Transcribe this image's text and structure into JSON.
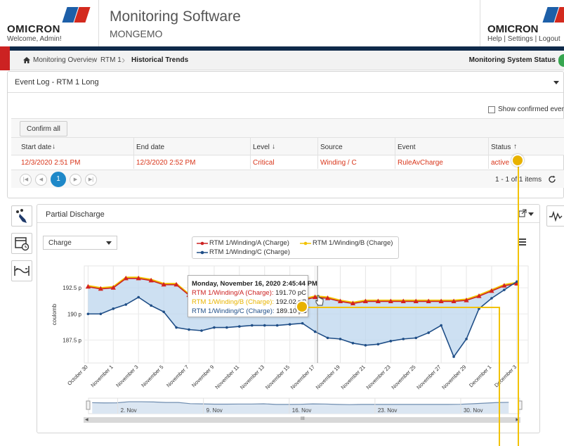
{
  "header": {
    "brand_left": "OMICRON",
    "welcome": "Welcome, Admin!",
    "title": "Monitoring Software",
    "subtitle": "MONGEMO",
    "brand_right": "OMICRON",
    "links": "Help | Settings | Logout"
  },
  "breadcrumb": {
    "items": [
      "Monitoring Overview",
      "RTM 1",
      "Historical Trends"
    ],
    "system_status": "Monitoring System Status"
  },
  "event_log": {
    "title": "Event Log - RTM 1 Long",
    "show_confirmed_label": "Show confirmed events",
    "confirm_all_label": "Confirm all",
    "columns": [
      "Start date",
      "End date",
      "Level",
      "Source",
      "Event",
      "Status"
    ],
    "rows": [
      [
        "12/3/2020 2:51 PM",
        "12/3/2020 2:52 PM",
        "Critical",
        "Winding / C",
        "RuleAvCharge",
        "active"
      ]
    ],
    "pager": {
      "current_page": "1",
      "summary": "1 - 1 of 1 items"
    },
    "colors": {
      "critical": "#d9361b",
      "pager_active": "#1e88c8"
    }
  },
  "chart_panel": {
    "title": "Partial Discharge",
    "select_value": "Charge",
    "tooltip": {
      "date": "Monday, November 16, 2020 2:45:44 PM",
      "a_label": "RTM 1/Winding/A (Charge):",
      "a_value": "191.70 pC",
      "b_label": "RTM 1/Winding/B (Charge):",
      "b_value": "192.02 pC",
      "c_label": "RTM 1/Winding/C (Charge):",
      "c_value": "189.10 pC"
    },
    "navigator_labels": [
      "2. Nov",
      "9. Nov",
      "16. Nov",
      "23. Nov",
      "30. Nov"
    ],
    "scrollbar_grip": "III"
  },
  "chart_data": {
    "type": "line",
    "title": "",
    "xlabel": "",
    "ylabel": "coulomb",
    "yticks": [
      "187.5 p",
      "190 p",
      "192.5 p"
    ],
    "ytick_values": [
      187.5,
      190,
      192.5
    ],
    "ylim": [
      185.3,
      194.6
    ],
    "xticks": [
      "October 30",
      "November 1",
      "November 3",
      "November 5",
      "November 7",
      "November 9",
      "November 11",
      "November 13",
      "November 15",
      "November 17",
      "November 19",
      "November 21",
      "November 23",
      "November 25",
      "November 27",
      "November 29",
      "December 1",
      "December 3"
    ],
    "xtick_days": [
      0,
      2,
      4,
      6,
      8,
      10,
      12,
      14,
      16,
      18,
      20,
      22,
      24,
      26,
      28,
      30,
      32,
      34
    ],
    "xlim": [
      -0.3,
      34.9
    ],
    "series": [
      {
        "name": "RTM 1/Winding/A (Charge)",
        "color": "#cc2222",
        "marker": "triangle",
        "days": [
          0,
          1,
          2,
          3,
          4,
          5,
          6,
          7,
          8,
          9,
          10,
          11,
          12,
          13,
          14,
          15,
          16,
          17,
          18,
          19,
          20,
          21,
          22,
          23,
          24,
          25,
          26,
          27,
          28,
          29,
          30,
          31,
          32,
          33,
          34
        ],
        "values": [
          192.6,
          192.4,
          192.5,
          193.4,
          193.4,
          193.2,
          192.8,
          192.8,
          191.8,
          191.6,
          191.4,
          191.4,
          191.5,
          191.5,
          191.7,
          191.2,
          191.2,
          191.3,
          191.6,
          191.5,
          191.2,
          191.0,
          191.2,
          191.2,
          191.2,
          191.2,
          191.2,
          191.2,
          191.2,
          191.2,
          191.3,
          191.7,
          192.2,
          192.7,
          192.9
        ]
      },
      {
        "name": "RTM 1/Winding/B (Charge)",
        "color": "#f2c200",
        "marker": "none",
        "days": [
          0,
          1,
          2,
          3,
          4,
          5,
          6,
          7,
          8,
          9,
          10,
          11,
          12,
          13,
          14,
          15,
          16,
          17,
          18,
          19,
          20,
          21,
          22,
          23,
          24,
          25,
          26,
          27,
          28,
          29,
          30,
          31,
          32,
          33,
          34
        ],
        "values": [
          192.7,
          192.5,
          192.6,
          193.5,
          193.5,
          193.3,
          192.9,
          192.9,
          191.9,
          191.7,
          191.5,
          191.5,
          191.6,
          191.6,
          191.8,
          191.3,
          191.3,
          191.4,
          191.7,
          191.6,
          191.3,
          191.1,
          191.3,
          191.3,
          191.3,
          191.3,
          191.3,
          191.3,
          191.3,
          191.3,
          191.4,
          191.8,
          192.3,
          192.8,
          193.0
        ]
      },
      {
        "name": "RTM 1/Winding/C (Charge)",
        "color": "#1f4e87",
        "marker": "none",
        "days": [
          0,
          1,
          2,
          3,
          4,
          5,
          6,
          7,
          8,
          9,
          10,
          11,
          12,
          13,
          14,
          15,
          16,
          17,
          18,
          19,
          20,
          21,
          22,
          23,
          24,
          25,
          26,
          27,
          28,
          29,
          30,
          31,
          32,
          33,
          34
        ],
        "values": [
          190.0,
          190.0,
          190.5,
          190.9,
          191.6,
          190.8,
          190.2,
          188.7,
          188.5,
          188.4,
          188.7,
          188.7,
          188.8,
          188.9,
          188.9,
          188.9,
          189.0,
          189.1,
          188.3,
          187.7,
          187.6,
          187.2,
          187.0,
          187.1,
          187.4,
          187.6,
          187.7,
          188.2,
          188.9,
          185.9,
          187.6,
          190.5,
          191.5,
          192.3,
          193.1
        ]
      }
    ],
    "grid": true,
    "legend_position": "top-center"
  }
}
